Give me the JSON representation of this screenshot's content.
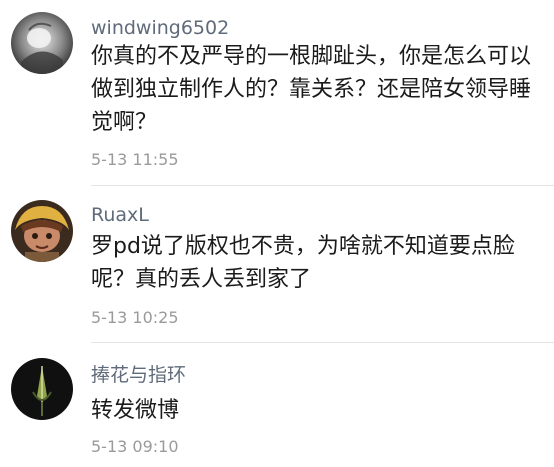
{
  "comments": [
    {
      "username": "windwing6502",
      "text": "你真的不及严导的一根脚趾头，你是怎么可以做到独立制作人的？靠关系？还是陪女领导睡觉啊？",
      "time": "5-13 11:55",
      "avatar_icon": "grayscale-photo-avatar"
    },
    {
      "username": "RuaxL",
      "text": "罗pd说了版权也不贵，为啥就不知道要点脸呢？真的丢人丢到家了",
      "time": "5-13 10:25",
      "avatar_icon": "cartoon-character-avatar"
    },
    {
      "username": "捧花与指环",
      "text": "转发微博",
      "time": "5-13 09:10",
      "avatar_icon": "dark-plant-avatar"
    }
  ]
}
